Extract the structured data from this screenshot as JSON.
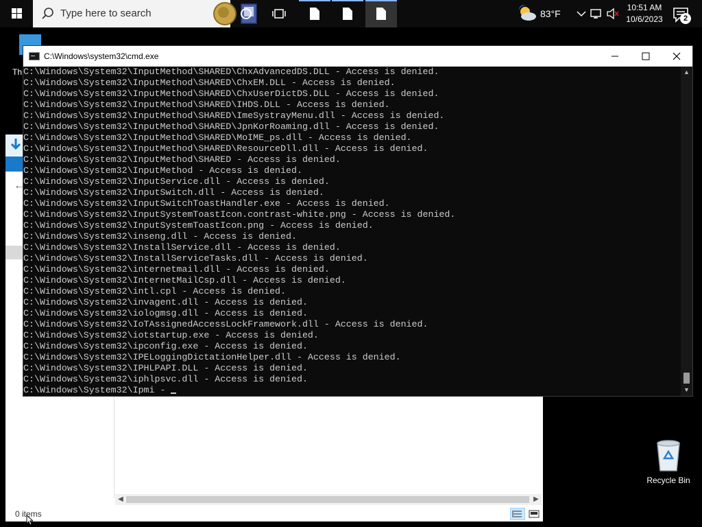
{
  "taskbar": {
    "search_placeholder": "Type here to search",
    "weather_temp": "83°F",
    "clock_time": "10:51 AM",
    "clock_date": "10/6/2023",
    "notification_count": "2"
  },
  "desktop": {
    "recycle_bin_label": "Recycle Bin",
    "peek_text": "Th"
  },
  "explorer": {
    "status_text": "0 items"
  },
  "cmd": {
    "title": "C:\\Windows\\system32\\cmd.exe",
    "lines": [
      "C:\\Windows\\System32\\InputMethod\\SHARED\\ChxAdvancedDS.DLL - Access is denied.",
      "C:\\Windows\\System32\\InputMethod\\SHARED\\ChxEM.DLL - Access is denied.",
      "C:\\Windows\\System32\\InputMethod\\SHARED\\ChxUserDictDS.DLL - Access is denied.",
      "C:\\Windows\\System32\\InputMethod\\SHARED\\IHDS.DLL - Access is denied.",
      "C:\\Windows\\System32\\InputMethod\\SHARED\\ImeSystrayMenu.dll - Access is denied.",
      "C:\\Windows\\System32\\InputMethod\\SHARED\\JpnKorRoaming.dll - Access is denied.",
      "C:\\Windows\\System32\\InputMethod\\SHARED\\MoIME_ps.dll - Access is denied.",
      "C:\\Windows\\System32\\InputMethod\\SHARED\\ResourceDll.dll - Access is denied.",
      "C:\\Windows\\System32\\InputMethod\\SHARED - Access is denied.",
      "C:\\Windows\\System32\\InputMethod - Access is denied.",
      "C:\\Windows\\System32\\InputService.dll - Access is denied.",
      "C:\\Windows\\System32\\InputSwitch.dll - Access is denied.",
      "C:\\Windows\\System32\\InputSwitchToastHandler.exe - Access is denied.",
      "C:\\Windows\\System32\\InputSystemToastIcon.contrast-white.png - Access is denied.",
      "C:\\Windows\\System32\\InputSystemToastIcon.png - Access is denied.",
      "C:\\Windows\\System32\\inseng.dll - Access is denied.",
      "C:\\Windows\\System32\\InstallService.dll - Access is denied.",
      "C:\\Windows\\System32\\InstallServiceTasks.dll - Access is denied.",
      "C:\\Windows\\System32\\internetmail.dll - Access is denied.",
      "C:\\Windows\\System32\\InternetMailCsp.dll - Access is denied.",
      "C:\\Windows\\System32\\intl.cpl - Access is denied.",
      "C:\\Windows\\System32\\invagent.dll - Access is denied.",
      "C:\\Windows\\System32\\iologmsg.dll - Access is denied.",
      "C:\\Windows\\System32\\IoTAssignedAccessLockFramework.dll - Access is denied.",
      "C:\\Windows\\System32\\iotstartup.exe - Access is denied.",
      "C:\\Windows\\System32\\ipconfig.exe - Access is denied.",
      "C:\\Windows\\System32\\IPELoggingDictationHelper.dll - Access is denied.",
      "C:\\Windows\\System32\\IPHLPAPI.DLL - Access is denied.",
      "C:\\Windows\\System32\\iphlpsvc.dll - Access is denied."
    ],
    "current_line": "C:\\Windows\\System32\\Ipmi - "
  },
  "icons": {
    "start": "windows-logo-icon",
    "search": "search-icon",
    "cortana": "cortana-circle-icon",
    "task_view": "task-view-icon",
    "apps": "document-app-icon",
    "weather": "weather-partly-cloudy-icon",
    "chevron": "chevron-up-icon",
    "network": "network-icon",
    "volume": "volume-muted-icon",
    "notifications": "action-center-icon",
    "recycle_bin": "recycle-bin-icon"
  }
}
